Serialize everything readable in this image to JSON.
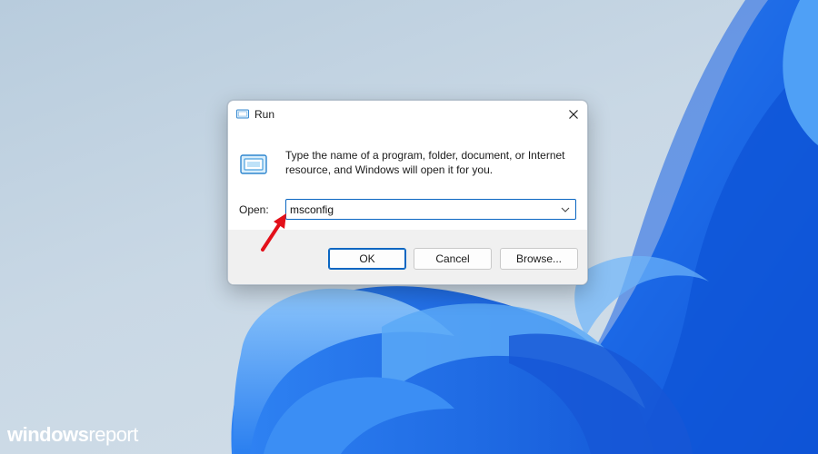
{
  "dialog": {
    "title": "Run",
    "description": "Type the name of a program, folder, document, or Internet resource, and Windows will open it for you.",
    "open_label": "Open:",
    "open_value": "msconfig",
    "buttons": {
      "ok": "OK",
      "cancel": "Cancel",
      "browse": "Browse..."
    }
  },
  "watermark": {
    "part1": "windows",
    "part2": "report"
  },
  "colors": {
    "accent": "#0a66c2",
    "annotation_arrow": "#e3101a",
    "wallpaper_blue": "#1e6fe8"
  }
}
